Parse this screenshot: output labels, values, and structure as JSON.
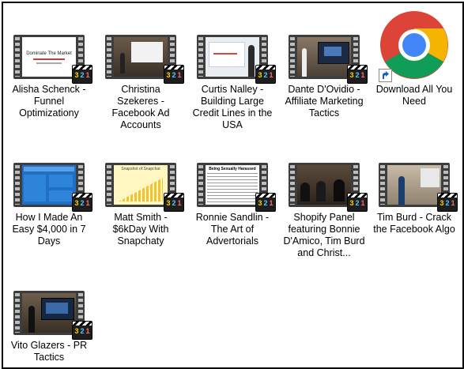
{
  "items": [
    {
      "label": "Alisha Schenck - Funnel Optimizationy",
      "slide_text": "Dominate The Market"
    },
    {
      "label": "Christina Szekeres - Facebook Ad Accounts"
    },
    {
      "label": "Curtis Nalley - Building Large Credit Lines in the USA"
    },
    {
      "label": "Dante D'Ovidio - Affiliate Marketing Tactics"
    },
    {
      "label": "Download All You Need"
    },
    {
      "label": "How I Made An Easy $4,000 in 7 Days"
    },
    {
      "label": "Matt Smith - $6kDay With Snapchaty",
      "slide_text": "Snapshot of Snapchat"
    },
    {
      "label": "Ronnie Sandlin - The Art of Advertorials",
      "slide_text": "Being Sexually Harassed At"
    },
    {
      "label": "Shopify Panel featuring Bonnie D'Amico, Tim Burd and Christ..."
    },
    {
      "label": "Tim Burd - Crack the Facebook Algo"
    },
    {
      "label": "Vito Glazers - PR Tactics"
    }
  ],
  "badge_number": "321",
  "colors": {
    "chrome_red": "#db4437",
    "chrome_green": "#0f9d58",
    "chrome_yellow": "#f4b400",
    "chrome_blue": "#4285f4"
  }
}
